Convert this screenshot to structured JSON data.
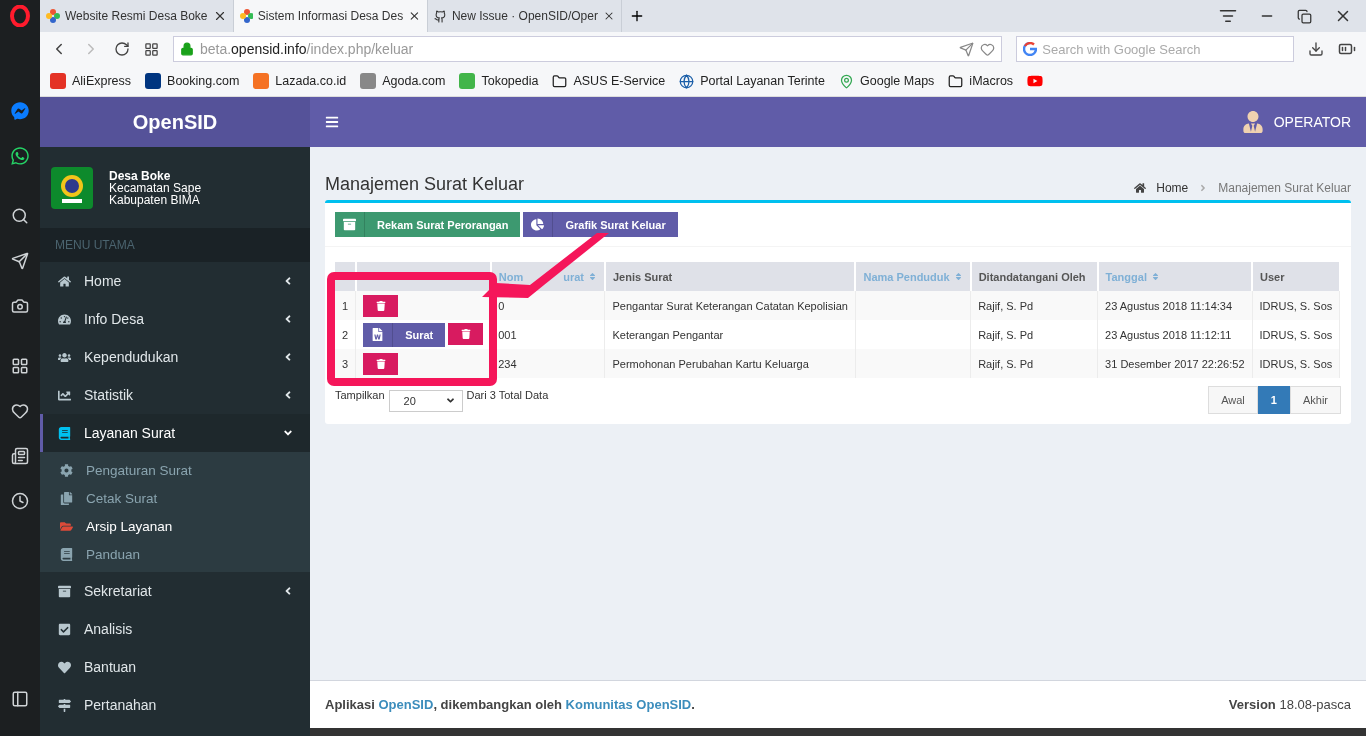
{
  "browser": {
    "tabs": [
      {
        "title": "Website Resmi Desa Boke",
        "selected": false,
        "kind": "site"
      },
      {
        "title": "Sistem Informasi Desa Des",
        "selected": true,
        "kind": "site"
      },
      {
        "title": "New Issue · OpenSID/Oper",
        "selected": false,
        "kind": "github"
      }
    ],
    "url": {
      "prefix": "beta.",
      "host": "opensid.info",
      "path": "/index.php/keluar"
    },
    "search": {
      "placeholder": "Search with Google Search"
    },
    "bookmarks": [
      {
        "label": "AliExpress",
        "kind": "ali"
      },
      {
        "label": "Booking.com",
        "kind": "booking"
      },
      {
        "label": "Lazada.co.id",
        "kind": "lazada"
      },
      {
        "label": "Agoda.com",
        "kind": "agoda"
      },
      {
        "label": "Tokopedia",
        "kind": "toko"
      },
      {
        "label": "ASUS E-Service",
        "kind": "folder"
      },
      {
        "label": "Portal Layanan Terinte",
        "kind": "globe"
      },
      {
        "label": "Google Maps",
        "kind": "maps"
      },
      {
        "label": "iMacros",
        "kind": "folder"
      },
      {
        "kind": "youtube"
      }
    ]
  },
  "app": {
    "brand": "OpenSID",
    "user": "OPERATOR",
    "village": {
      "name": "Desa Boke",
      "district": "Kecamatan Sape",
      "regency": "Kabupaten BIMA"
    },
    "menu_header": "MENU UTAMA",
    "menu": [
      {
        "label": "Home",
        "kind": "submenu",
        "expanded": false,
        "selected": false
      },
      {
        "label": "Info Desa",
        "kind": "submenu",
        "expanded": false,
        "selected": false
      },
      {
        "label": "Kependudukan",
        "kind": "submenu",
        "expanded": false,
        "selected": false
      },
      {
        "label": "Statistik",
        "kind": "submenu",
        "expanded": false,
        "selected": false
      },
      {
        "label": "Layanan Surat",
        "kind": "submenu",
        "expanded": true,
        "selected": true,
        "children": [
          {
            "label": "Pengaturan Surat",
            "selected": false
          },
          {
            "label": "Cetak Surat",
            "selected": false
          },
          {
            "label": "Arsip Layanan",
            "selected": true
          },
          {
            "label": "Panduan",
            "selected": false
          }
        ]
      },
      {
        "label": "Sekretariat",
        "kind": "submenu",
        "expanded": false,
        "selected": false
      },
      {
        "label": "Analisis",
        "kind": "link",
        "selected": false
      },
      {
        "label": "Bantuan",
        "kind": "link",
        "selected": false
      },
      {
        "label": "Pertanahan",
        "kind": "link",
        "selected": false
      }
    ],
    "page_title": "Manajemen Surat Keluar",
    "breadcrumb": [
      "Home",
      "Manajemen Surat Keluar"
    ],
    "actions": [
      {
        "label": "Rekam Surat Perorangan",
        "kind": "archive"
      },
      {
        "label": "Grafik Surat Keluar",
        "kind": "chart"
      }
    ],
    "table": {
      "columns": [
        {
          "sortable": false
        },
        {
          "sortable": false
        },
        {
          "label_parts": [
            "Nom",
            "urat"
          ],
          "sortable": true
        },
        {
          "label_parts": [
            "Jenis Surat"
          ],
          "sortable": false
        },
        {
          "label_parts": [
            "Nama Penduduk"
          ],
          "sortable": true
        },
        {
          "label_parts": [
            "Ditandatangani Oleh"
          ],
          "sortable": false
        },
        {
          "label_parts": [
            "Tanggal"
          ],
          "sortable": true
        },
        {
          "label_parts": [
            "User"
          ],
          "sortable": false
        }
      ],
      "rows": [
        {
          "no": "1",
          "buttons": [
            {
              "kind": "delete"
            }
          ],
          "nomor": "0",
          "jenis": "Pengantar Surat Keterangan Catatan Kepolisian",
          "signer": "Rajif, S. Pd",
          "tanggal": "23 Agustus 2018 11:14:34",
          "user": "IDRUS, S. Sos"
        },
        {
          "no": "2",
          "buttons": [
            {
              "kind": "word",
              "label": "Surat"
            },
            {
              "kind": "delete"
            }
          ],
          "nomor": "001",
          "jenis": "Keterangan Pengantar",
          "signer": "Rajif, S. Pd",
          "tanggal": "23 Agustus 2018 11:12:11",
          "user": "IDRUS, S. Sos"
        },
        {
          "no": "3",
          "buttons": [
            {
              "kind": "delete"
            }
          ],
          "nomor": "234",
          "jenis": "Permohonan Perubahan Kartu Keluarga",
          "signer": "Rajif, S. Pd",
          "tanggal": "31 Desember 2017 22:26:52",
          "user": "IDRUS, S. Sos"
        }
      ]
    },
    "page_size_label": "Tampilkan",
    "page_size": "20",
    "total": "Dari 3 Total Data",
    "pagination": [
      {
        "label": "Awal",
        "selected": false
      },
      {
        "label": "1",
        "selected": true
      },
      {
        "label": "Akhir",
        "selected": false
      }
    ],
    "footer": {
      "parts": [
        {
          "text": "Aplikasi ",
          "link": false
        },
        {
          "text": "OpenSID",
          "link": true
        },
        {
          "text": ", dikembangkan oleh ",
          "link": false
        },
        {
          "text": "Komunitas OpenSID",
          "link": true
        },
        {
          "text": ".",
          "link": false
        }
      ],
      "version_label": "Version",
      "version": "18.08-pasca"
    },
    "annotation": {
      "kind": "arrow-box"
    }
  }
}
